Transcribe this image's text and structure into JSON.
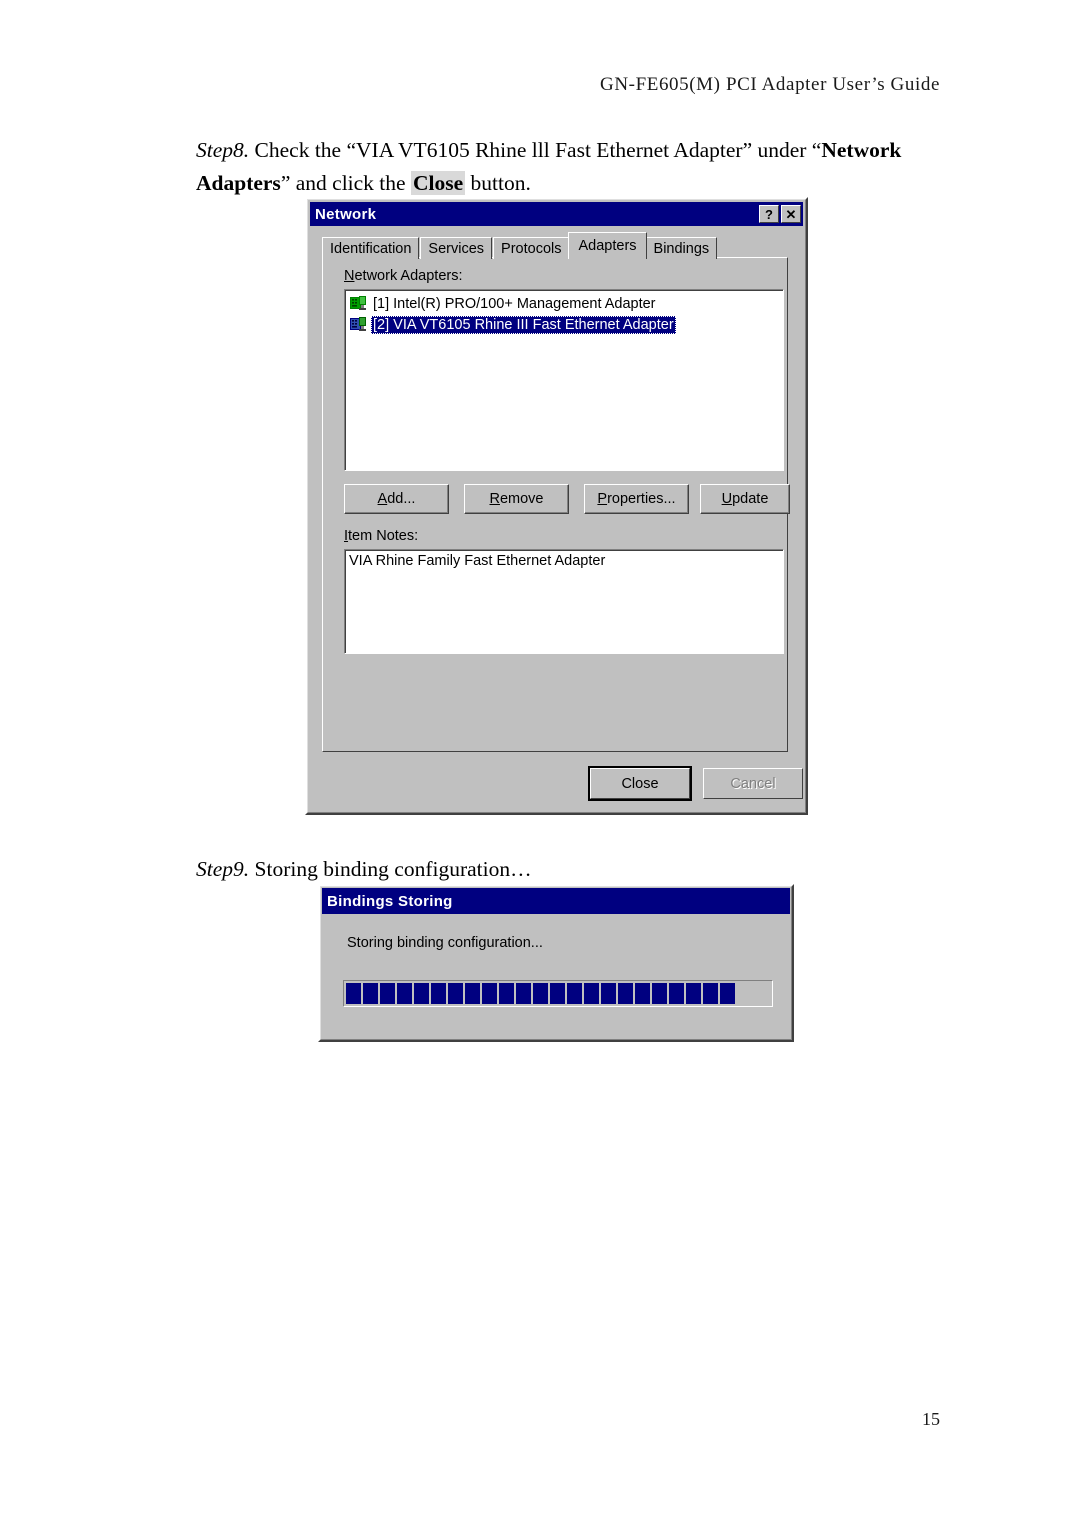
{
  "page": {
    "header": "GN-FE605(M)  PCI  Adapter  User’s  Guide",
    "number": "15"
  },
  "step8": {
    "label": "Step8.",
    "text_a": " Check the “VIA VT6105 Rhine lll Fast Ethernet Adapter” under “",
    "bold_b": "Network Adapters",
    "text_c": "” and click the ",
    "highlight_d": "Close",
    "text_e": " button."
  },
  "step9": {
    "label": "Step9.",
    "text": " Storing binding configuration…"
  },
  "network_dialog": {
    "title": "Network",
    "help_button": "?",
    "close_button": "✕",
    "tabs": [
      {
        "label": "Identification",
        "active": false
      },
      {
        "label": "Services",
        "active": false
      },
      {
        "label": "Protocols",
        "active": false
      },
      {
        "label": "Adapters",
        "active": true
      },
      {
        "label": "Bindings",
        "active": false
      }
    ],
    "adapters_label_acc": "N",
    "adapters_label_rest": "etwork Adapters:",
    "adapters": [
      {
        "text": "[1] Intel(R) PRO/100+ Management Adapter",
        "selected": false,
        "icon": "network-adapter-card-icon"
      },
      {
        "text": "[2] VIA VT6105 Rhine III Fast Ethernet Adapter",
        "selected": true,
        "icon": "network-adapter-card-icon"
      }
    ],
    "buttons": {
      "add_acc": "A",
      "add_rest": "dd...",
      "remove_acc": "R",
      "remove_rest": "emove",
      "properties_acc": "P",
      "properties_rest": "roperties...",
      "update_acc": "U",
      "update_rest": "pdate"
    },
    "notes_label_acc": "I",
    "notes_label_rest": "tem Notes:",
    "notes_text": "VIA Rhine Family Fast Ethernet Adapter",
    "footer": {
      "close": "Close",
      "cancel": "Cancel",
      "cancel_disabled": true
    },
    "colors": {
      "titlebar": "#000080",
      "face": "#c0c0c0",
      "selection": "#000080",
      "disabled_text": "#808080"
    }
  },
  "bindings_dialog": {
    "title": "Bindings Storing",
    "status": "Storing binding configuration...",
    "progress": {
      "blocks_filled": 23,
      "blocks_total": 25,
      "percent": 92,
      "block_color": "#000080"
    }
  }
}
